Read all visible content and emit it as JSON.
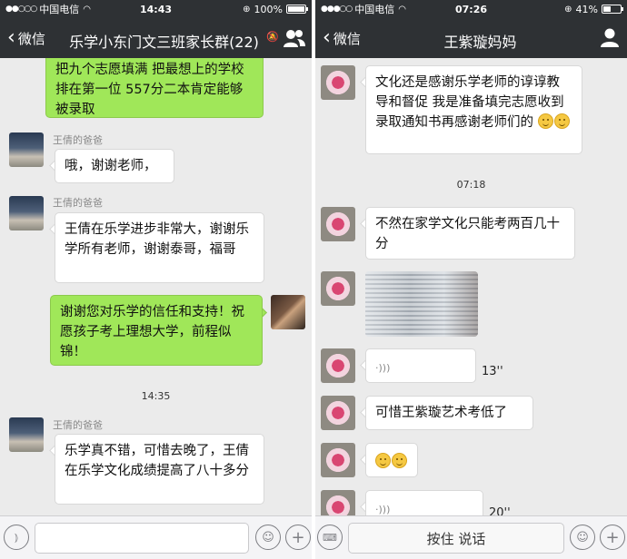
{
  "left": {
    "status": {
      "carrier": "中国电信",
      "time": "14:43",
      "battery": "100%",
      "battery_level": 1.0
    },
    "nav": {
      "back_label": "微信",
      "title": "乐学小东门文三班家长群(22)"
    },
    "messages": {
      "m0": {
        "text": "把九个志愿填满 把最想上的学校排在第一位 557分二本肯定能够被录取"
      },
      "m1": {
        "sender": "王倩的爸爸",
        "text": "哦，谢谢老师，"
      },
      "m2": {
        "sender": "王倩的爸爸",
        "text": "王倩在乐学进步非常大，谢谢乐学所有老师，谢谢泰哥，福哥"
      },
      "m3": {
        "text": "谢谢您对乐学的信任和支持！祝愿孩子考上理想大学，前程似锦！"
      },
      "ts": "14:35",
      "m4": {
        "sender": "王倩的爸爸",
        "text": "乐学真不错，可惜去晚了，王倩在乐学文化成绩提高了八十多分"
      }
    }
  },
  "right": {
    "status": {
      "carrier": "中国电信",
      "time": "07:26",
      "battery": "41%",
      "battery_level": 0.41
    },
    "nav": {
      "back_label": "微信",
      "title": "王紫璇妈妈"
    },
    "messages": {
      "m0": {
        "text": "文化还是感谢乐学老师的谆谆教导和督促 我是准备填完志愿收到录取通知书再感谢老师们的"
      },
      "ts": "07:18",
      "m1": {
        "text": "不然在家学文化只能考两百几十分"
      },
      "m3": {
        "duration": "13''"
      },
      "m4": {
        "text": "可惜王紫璇艺术考低了"
      },
      "m6": {
        "duration": "20''"
      }
    },
    "input": {
      "hold_to_talk": "按住 说话"
    }
  },
  "colors": {
    "bar": "#2e3134",
    "chat_bg": "#ebebeb",
    "self_bubble": "#a0e759"
  },
  "icons": [
    "wifi-icon",
    "chevron-left-icon",
    "mute-icon",
    "group-icon",
    "person-icon",
    "voice-icon",
    "emoji-icon",
    "plus-icon",
    "keyboard-icon"
  ]
}
